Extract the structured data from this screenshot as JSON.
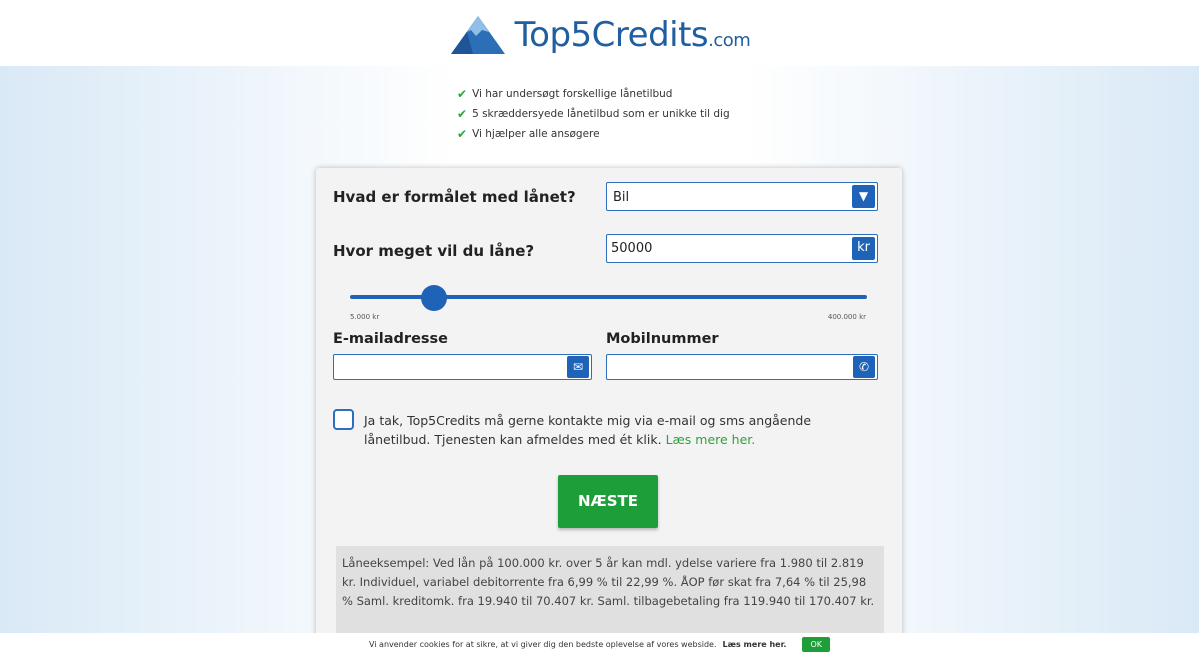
{
  "header": {
    "logo_main": "Top5Credits",
    "logo_suffix": ".com"
  },
  "benefits": [
    "Vi har undersøgt forskellige lånetilbud",
    "5 skræddersyede lånetilbud som er unikke til dig",
    "Vi hjælper alle ansøgere"
  ],
  "form": {
    "purpose_label": "Hvad er formålet med lånet?",
    "purpose_value": "Bil",
    "amount_label": "Hvor meget vil du låne?",
    "amount_value": "50000",
    "amount_unit": "kr",
    "slider": {
      "min_label": "5.000 kr",
      "max_label": "400.000 kr",
      "min": 5000,
      "max": 400000,
      "value": 50000
    },
    "email_label": "E-mailadresse",
    "email_value": "",
    "phone_label": "Mobilnummer",
    "phone_value": "",
    "consent_text": "Ja tak, Top5Credits må gerne kontakte mig via e-mail og sms angående lånetilbud. Tjenesten kan afmeldes med ét klik.",
    "consent_link": "Læs mere her.",
    "next_button": "NÆSTE",
    "loan_example": "Låneeksempel: Ved lån på 100.000 kr. over 5 år kan mdl. ydelse variere fra 1.980 til 2.819 kr. Individuel, variabel debitorrente fra 6,99 % til 22,99 %. ÅOP før skat fra 7,64 % til 25,98 % Saml. kreditomk. fra 19.940 til 70.407 kr. Saml. tilbagebetaling fra 119.940 til 170.407 kr."
  },
  "cookie": {
    "text": "Vi anvender cookies for at sikre, at vi giver dig den bedste oplevelse af vores webside.",
    "more": "Læs mere her.",
    "ok": "OK"
  },
  "colors": {
    "brand_blue": "#1f63b8",
    "green": "#1e9e38"
  }
}
